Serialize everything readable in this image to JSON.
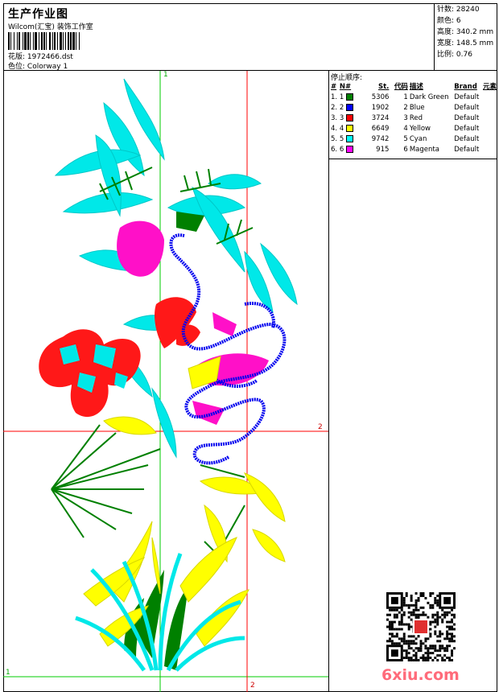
{
  "header": {
    "title": "生产作业图",
    "company": "Wilcom(汇宝) 装饰工作室",
    "design_file_label": "花版:",
    "design_file": "1972466.dst",
    "colorway_label": "色位:",
    "colorway": "Colorway 1"
  },
  "stats": [
    {
      "label": "针数:",
      "value": "28240"
    },
    {
      "label": "颜色:",
      "value": "6"
    },
    {
      "label": "高度:",
      "value": "340.2 mm"
    },
    {
      "label": "宽度:",
      "value": "148.5 mm"
    },
    {
      "label": "比例:",
      "value": "0.76"
    }
  ],
  "stop_sequence": {
    "label": "停止顺序:",
    "columns": [
      "#",
      "N#",
      "St.",
      "代码",
      "描述",
      "Brand",
      "元素"
    ],
    "rows": [
      {
        "num": "1.",
        "n": "1",
        "color": "#008000",
        "stitches": "5306",
        "code": "1",
        "desc": "Dark Green",
        "brand": "Default"
      },
      {
        "num": "2.",
        "n": "2",
        "color": "#0000ff",
        "stitches": "1902",
        "code": "2",
        "desc": "Blue",
        "brand": "Default"
      },
      {
        "num": "3.",
        "n": "3",
        "color": "#ff0000",
        "stitches": "3724",
        "code": "3",
        "desc": "Red",
        "brand": "Default"
      },
      {
        "num": "4.",
        "n": "4",
        "color": "#ffff00",
        "stitches": "6649",
        "code": "4",
        "desc": "Yellow",
        "brand": "Default"
      },
      {
        "num": "5.",
        "n": "5",
        "color": "#00ffff",
        "stitches": "9742",
        "code": "5",
        "desc": "Cyan",
        "brand": "Default"
      },
      {
        "num": "6.",
        "n": "6",
        "color": "#ff00ff",
        "stitches": "915",
        "code": "6",
        "desc": "Magenta",
        "brand": "Default"
      }
    ]
  },
  "guides": {
    "v1": "1",
    "h2": "2",
    "v2": "2",
    "h1": "1"
  },
  "watermark": "6xiu.com"
}
